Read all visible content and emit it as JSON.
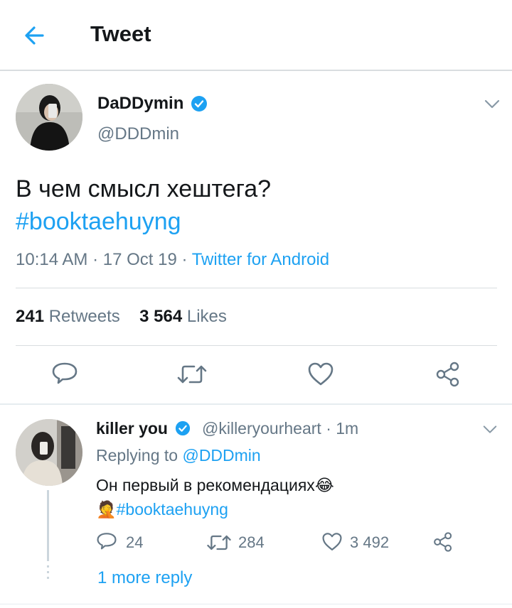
{
  "header": {
    "title": "Tweet",
    "back_icon": "arrow-left-icon"
  },
  "tweet": {
    "author_name": "DaDDymin",
    "author_handle": "@DDDmin",
    "text_line1": "В чем смысл хештега?",
    "hashtag": "#booktaehuyng",
    "time": "10:14 AM",
    "date": "17 Oct 19",
    "source": "Twitter for Android",
    "retweets_count": "241",
    "retweets_label": "Retweets",
    "likes_count": "3 564",
    "likes_label": "Likes"
  },
  "reply": {
    "author_name": "killer you",
    "author_handle": "@killeryourheart",
    "time": "1m",
    "replying_label": "Replying to",
    "replying_to": "@DDDmin",
    "text_line1": "Он первый в рекомендациях",
    "emoji_laugh": "😂",
    "emoji_facepalm": "🤦",
    "hashtag": "#booktaehuyng",
    "reply_count": "24",
    "retweet_count": "284",
    "like_count": "3 492"
  },
  "more_reply": "1 more reply",
  "colors": {
    "accent": "#1da1f2",
    "muted": "#657786",
    "text": "#14171a",
    "divider": "#d9dde0"
  },
  "icons": [
    "arrow-left-icon",
    "verified-badge-icon",
    "chevron-down-icon",
    "reply-icon",
    "retweet-icon",
    "like-icon",
    "share-icon"
  ]
}
